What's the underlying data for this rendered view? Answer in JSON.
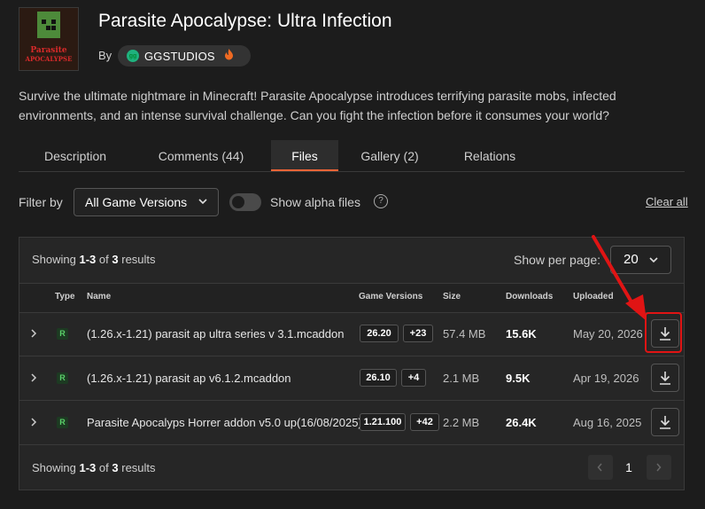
{
  "project": {
    "title": "Parasite Apocalypse: Ultra Infection",
    "by_label": "By",
    "author": "GGSTUDIOS",
    "thumbnail_text": [
      "Parasite",
      "APOCALYPSE"
    ],
    "description": "Survive the ultimate nightmare in Minecraft! Parasite Apocalypse introduces terrifying parasite mobs, infected environments, and an intense survival challenge. Can you fight the infection before it consumes your world?"
  },
  "tabs": [
    {
      "label": "Description",
      "active": false
    },
    {
      "label": "Comments (44)",
      "active": false
    },
    {
      "label": "Files",
      "active": true
    },
    {
      "label": "Gallery (2)",
      "active": false
    },
    {
      "label": "Relations",
      "active": false
    }
  ],
  "filters": {
    "filter_by_label": "Filter by",
    "game_version_selected": "All Game Versions",
    "alpha_toggle_label": "Show alpha files",
    "alpha_toggle_on": false,
    "clear_all": "Clear all"
  },
  "results": {
    "showing_prefix": "Showing",
    "range": "1-3",
    "of": "of",
    "total": "3",
    "suffix": "results",
    "per_page_label": "Show per page:",
    "per_page_value": "20",
    "current_page": "1"
  },
  "columns": {
    "type": "Type",
    "name": "Name",
    "game_versions": "Game Versions",
    "size": "Size",
    "downloads": "Downloads",
    "uploaded": "Uploaded"
  },
  "files": [
    {
      "type": "R",
      "name": "(1.26.x-1.21) parasit ap ultra series v 3.1.mcaddon",
      "version": "26.20",
      "more_versions": "+23",
      "size": "57.4 MB",
      "downloads": "15.6K",
      "uploaded": "May 20, 2026"
    },
    {
      "type": "R",
      "name": "(1.26.x-1.21) parasit ap v6.1.2.mcaddon",
      "version": "26.10",
      "more_versions": "+4",
      "size": "2.1 MB",
      "downloads": "9.5K",
      "uploaded": "Apr 19, 2026"
    },
    {
      "type": "R",
      "name": "Parasite Apocalyps Horrer addon v5.0 up(16/08/2025)",
      "version": "1.21.100",
      "more_versions": "+42",
      "size": "2.2 MB",
      "downloads": "26.4K",
      "uploaded": "Aug 16, 2025"
    }
  ],
  "colors": {
    "accent": "#f16436",
    "release_badge": "#5bd16a",
    "author_avatar": "#1fb27e",
    "annotation_red": "#e01414"
  },
  "icons": [
    "chevron-down-icon",
    "chevron-right-icon",
    "download-icon",
    "help-circle-icon",
    "fire-icon",
    "chevron-left-icon"
  ]
}
